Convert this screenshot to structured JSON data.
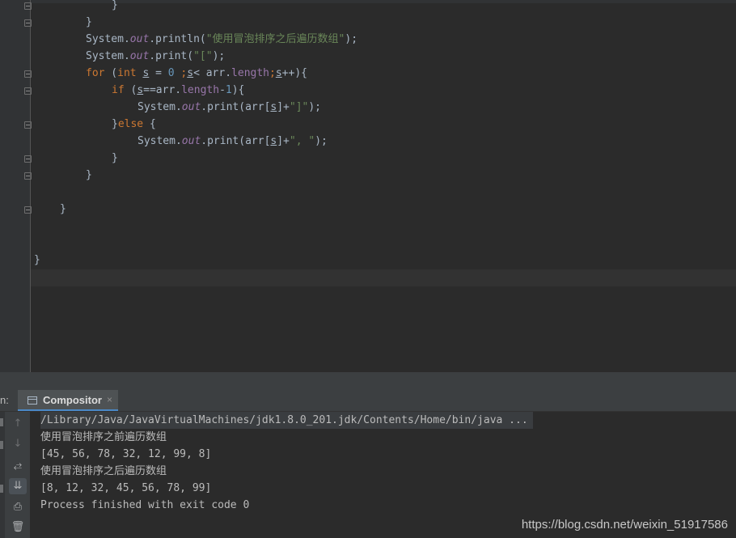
{
  "code": {
    "l1": "}",
    "l2": "}",
    "l3": {
      "obj": "System",
      "field": "out",
      "method": "println",
      "str": "\"使用冒泡排序之后遍历数组\""
    },
    "l4": {
      "obj": "System",
      "field": "out",
      "method": "print",
      "str": "\"[\""
    },
    "l5": {
      "kw_for": "for",
      "kw_int": "int",
      "var": "s",
      "zero": "0",
      "arr": "arr",
      "length": "length"
    },
    "l6": {
      "kw_if": "if",
      "var": "s",
      "arr": "arr",
      "length": "length",
      "one": "1"
    },
    "l7": {
      "obj": "System",
      "field": "out",
      "method": "print",
      "arr": "arr",
      "var": "s",
      "str": "\"]\""
    },
    "l8": {
      "kw_else": "else"
    },
    "l9": {
      "obj": "System",
      "field": "out",
      "method": "print",
      "arr": "arr",
      "var": "s",
      "str": "\", \""
    },
    "l10": "}",
    "l11": "}",
    "l12": "}",
    "l13": "}"
  },
  "run_panel": {
    "label": "n:",
    "tab_title": "Compositor",
    "tab_close": "×"
  },
  "toolbar_icons": [
    "arrow-up-icon",
    "arrow-down-icon",
    "soft-wrap-icon",
    "scroll-to-end-icon",
    "print-icon",
    "trash-icon"
  ],
  "console": {
    "lines": [
      "/Library/Java/JavaVirtualMachines/jdk1.8.0_201.jdk/Contents/Home/bin/java ...",
      "使用冒泡排序之前遍历数组",
      "[45, 56, 78, 32, 12, 99, 8]",
      "使用冒泡排序之后遍历数组",
      "[8, 12, 32, 45, 56, 78, 99]",
      "Process finished with exit code 0"
    ]
  },
  "watermark": "https://blog.csdn.net/weixin_51917586"
}
